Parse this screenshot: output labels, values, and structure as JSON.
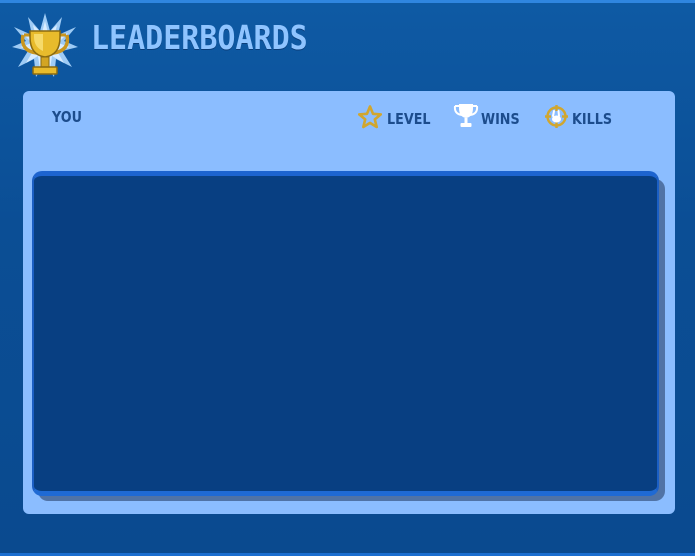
{
  "header": {
    "title": "LEADERBOARDS",
    "trophy_icon": "trophy-icon"
  },
  "columns": {
    "you": "YOU",
    "level": "LEVEL",
    "wins": "WINS",
    "kills": "KILLS",
    "level_icon": "star-icon",
    "wins_icon": "trophy-icon",
    "kills_icon": "crosshair-icon"
  },
  "leaderboard": {
    "rows": []
  },
  "colors": {
    "background": "#0b4a8e",
    "panel": "#8bbdff",
    "list": "#083f82",
    "title": "#8fc4ff",
    "gold": "#e2b52a"
  }
}
